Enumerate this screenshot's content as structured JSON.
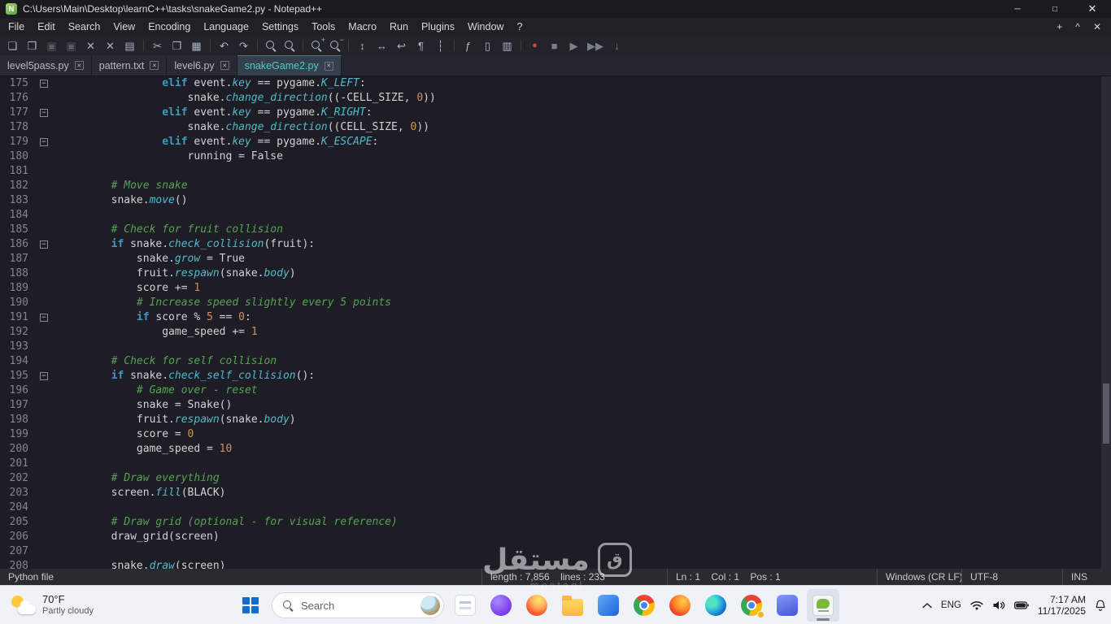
{
  "titlebar": {
    "title": "C:\\Users\\Main\\Desktop\\learnC++\\tasks\\snakeGame2.py - Notepad++",
    "logo_letter": "N",
    "controls": {
      "minimize": "─",
      "maximize": "□",
      "close": "✕"
    }
  },
  "menubar": {
    "items": [
      "File",
      "Edit",
      "Search",
      "View",
      "Encoding",
      "Language",
      "Settings",
      "Tools",
      "Macro",
      "Run",
      "Plugins",
      "Window",
      "?"
    ],
    "right_buttons": [
      {
        "name": "menu-plus-button",
        "glyph": "+"
      },
      {
        "name": "menu-collapse-button",
        "glyph": "^"
      },
      {
        "name": "menu-close-button",
        "glyph": "✕"
      }
    ]
  },
  "toolbar": {
    "icons": [
      {
        "name": "new-file",
        "g": "❏",
        "c": "ic"
      },
      {
        "name": "open-file",
        "g": "❒",
        "c": "ic"
      },
      {
        "name": "save-file",
        "g": "▣",
        "c": "dis"
      },
      {
        "name": "save-all",
        "g": "▣",
        "c": "dis"
      },
      {
        "name": "close-file",
        "g": "✕",
        "c": "ic"
      },
      {
        "name": "close-all",
        "g": "✕",
        "c": "ic"
      },
      {
        "name": "print",
        "g": "▤",
        "c": "ic"
      },
      {
        "sep": true
      },
      {
        "name": "cut",
        "g": "✂",
        "c": "ic"
      },
      {
        "name": "copy",
        "g": "❐",
        "c": "ic"
      },
      {
        "name": "paste",
        "g": "▦",
        "c": "ic"
      },
      {
        "sep": true
      },
      {
        "name": "undo",
        "g": "↶",
        "c": "ic"
      },
      {
        "name": "redo",
        "g": "↷",
        "c": "ic"
      },
      {
        "sep": true
      },
      {
        "name": "find",
        "type": "mag"
      },
      {
        "name": "replace",
        "type": "mag"
      },
      {
        "sep": true
      },
      {
        "name": "zoom-in",
        "type": "mag",
        "badge": "+"
      },
      {
        "name": "zoom-out",
        "type": "mag",
        "badge": "−"
      },
      {
        "sep": true
      },
      {
        "name": "sync-vertical-scrolling",
        "g": "↕",
        "c": "ic"
      },
      {
        "name": "sync-horizontal-scrolling",
        "g": "↔",
        "c": "ic"
      },
      {
        "name": "word-wrap",
        "g": "↩",
        "c": "ic"
      },
      {
        "name": "show-all-characters",
        "g": "¶",
        "c": "ic"
      },
      {
        "name": "indent-guide",
        "g": "┆",
        "c": "ic"
      },
      {
        "sep": true
      },
      {
        "name": "function-list",
        "g": "ƒ",
        "c": "ic"
      },
      {
        "name": "document-map",
        "g": "▯",
        "c": "ic"
      },
      {
        "name": "document-switcher",
        "g": "▥",
        "c": "ic"
      },
      {
        "sep": true
      },
      {
        "name": "record-macro",
        "g": "●",
        "c": "rec"
      },
      {
        "name": "stop-recording",
        "g": "■",
        "c": "dis2"
      },
      {
        "name": "play-macro",
        "g": "▶",
        "c": "dis2"
      },
      {
        "name": "run-macro-multiple-times",
        "g": "▶▶",
        "c": "dis2"
      },
      {
        "name": "save-macro",
        "g": "↓",
        "c": "dis2"
      }
    ]
  },
  "tabbar": {
    "close_glyph": "✕",
    "tabs": [
      {
        "label": "level5pass.py",
        "active": false
      },
      {
        "label": "pattern.txt",
        "active": false
      },
      {
        "label": "level6.py",
        "active": false
      },
      {
        "label": "snakeGame2.py",
        "active": true
      }
    ]
  },
  "editor": {
    "fold_glyph": "−",
    "lines": [
      {
        "n": 175,
        "fold": true,
        "t": [
          [
            "                ",
            "d"
          ],
          [
            "elif",
            "k"
          ],
          [
            " event.",
            "d"
          ],
          [
            "key",
            "m"
          ],
          [
            " == pygame.",
            "d"
          ],
          [
            "K_LEFT",
            "m"
          ],
          [
            ":",
            "d"
          ]
        ]
      },
      {
        "n": 176,
        "t": [
          [
            "                    snake.",
            "d"
          ],
          [
            "change_direction",
            "m"
          ],
          [
            "((-CELL_SIZE, ",
            "d"
          ],
          [
            "0",
            "n"
          ],
          [
            "))",
            "d"
          ]
        ]
      },
      {
        "n": 177,
        "fold": true,
        "t": [
          [
            "                ",
            "d"
          ],
          [
            "elif",
            "k"
          ],
          [
            " event.",
            "d"
          ],
          [
            "key",
            "m"
          ],
          [
            " == pygame.",
            "d"
          ],
          [
            "K_RIGHT",
            "m"
          ],
          [
            ":",
            "d"
          ]
        ]
      },
      {
        "n": 178,
        "t": [
          [
            "                    snake.",
            "d"
          ],
          [
            "change_direction",
            "m"
          ],
          [
            "((CELL_SIZE, ",
            "d"
          ],
          [
            "0",
            "n"
          ],
          [
            "))",
            "d"
          ]
        ]
      },
      {
        "n": 179,
        "fold": true,
        "t": [
          [
            "                ",
            "d"
          ],
          [
            "elif",
            "k"
          ],
          [
            " event.",
            "d"
          ],
          [
            "key",
            "m"
          ],
          [
            " == pygame.",
            "d"
          ],
          [
            "K_ESCAPE",
            "m"
          ],
          [
            ":",
            "d"
          ]
        ]
      },
      {
        "n": 180,
        "t": [
          [
            "                    running = False",
            "d"
          ]
        ]
      },
      {
        "n": 181,
        "t": []
      },
      {
        "n": 182,
        "t": [
          [
            "        ",
            "d"
          ],
          [
            "# Move snake",
            "c"
          ]
        ]
      },
      {
        "n": 183,
        "t": [
          [
            "        snake.",
            "d"
          ],
          [
            "move",
            "m"
          ],
          [
            "()",
            "d"
          ]
        ]
      },
      {
        "n": 184,
        "t": []
      },
      {
        "n": 185,
        "t": [
          [
            "        ",
            "d"
          ],
          [
            "# Check for fruit collision",
            "c"
          ]
        ]
      },
      {
        "n": 186,
        "fold": true,
        "t": [
          [
            "        ",
            "d"
          ],
          [
            "if",
            "k"
          ],
          [
            " snake.",
            "d"
          ],
          [
            "check_collision",
            "m"
          ],
          [
            "(fruit):",
            "d"
          ]
        ]
      },
      {
        "n": 187,
        "t": [
          [
            "            snake.",
            "d"
          ],
          [
            "grow",
            "m"
          ],
          [
            " = True",
            "d"
          ]
        ]
      },
      {
        "n": 188,
        "t": [
          [
            "            fruit.",
            "d"
          ],
          [
            "respawn",
            "m"
          ],
          [
            "(snake.",
            "d"
          ],
          [
            "body",
            "m"
          ],
          [
            ")",
            "d"
          ]
        ]
      },
      {
        "n": 189,
        "t": [
          [
            "            score += ",
            "d"
          ],
          [
            "1",
            "n"
          ]
        ]
      },
      {
        "n": 190,
        "t": [
          [
            "            ",
            "d"
          ],
          [
            "# Increase speed slightly every 5 points",
            "c"
          ]
        ]
      },
      {
        "n": 191,
        "fold": true,
        "t": [
          [
            "            ",
            "d"
          ],
          [
            "if",
            "k"
          ],
          [
            " score % ",
            "d"
          ],
          [
            "5",
            "n"
          ],
          [
            " == ",
            "d"
          ],
          [
            "0",
            "n"
          ],
          [
            ":",
            "d"
          ]
        ]
      },
      {
        "n": 192,
        "t": [
          [
            "                game_speed += ",
            "d"
          ],
          [
            "1",
            "n"
          ]
        ]
      },
      {
        "n": 193,
        "t": []
      },
      {
        "n": 194,
        "t": [
          [
            "        ",
            "d"
          ],
          [
            "# Check for self collision",
            "c"
          ]
        ]
      },
      {
        "n": 195,
        "fold": true,
        "t": [
          [
            "        ",
            "d"
          ],
          [
            "if",
            "k"
          ],
          [
            " snake.",
            "d"
          ],
          [
            "check_self_collision",
            "m"
          ],
          [
            "():",
            "d"
          ]
        ]
      },
      {
        "n": 196,
        "t": [
          [
            "            ",
            "d"
          ],
          [
            "# Game over - reset",
            "c"
          ]
        ]
      },
      {
        "n": 197,
        "t": [
          [
            "            snake = Snake()",
            "d"
          ]
        ]
      },
      {
        "n": 198,
        "t": [
          [
            "            fruit.",
            "d"
          ],
          [
            "respawn",
            "m"
          ],
          [
            "(snake.",
            "d"
          ],
          [
            "body",
            "m"
          ],
          [
            ")",
            "d"
          ]
        ]
      },
      {
        "n": 199,
        "t": [
          [
            "            score = ",
            "d"
          ],
          [
            "0",
            "n"
          ]
        ]
      },
      {
        "n": 200,
        "t": [
          [
            "            game_speed = ",
            "d"
          ],
          [
            "10",
            "n"
          ]
        ]
      },
      {
        "n": 201,
        "t": []
      },
      {
        "n": 202,
        "t": [
          [
            "        ",
            "d"
          ],
          [
            "# Draw everything",
            "c"
          ]
        ]
      },
      {
        "n": 203,
        "t": [
          [
            "        screen.",
            "d"
          ],
          [
            "fill",
            "m"
          ],
          [
            "(BLACK)",
            "d"
          ]
        ]
      },
      {
        "n": 204,
        "t": []
      },
      {
        "n": 205,
        "t": [
          [
            "        ",
            "d"
          ],
          [
            "# Draw grid (optional - for visual reference)",
            "c"
          ]
        ]
      },
      {
        "n": 206,
        "t": [
          [
            "        draw_grid(screen)",
            "d"
          ]
        ]
      },
      {
        "n": 207,
        "t": []
      },
      {
        "n": 208,
        "t": [
          [
            "        snake.",
            "d"
          ],
          [
            "draw",
            "m"
          ],
          [
            "(screen)",
            "d"
          ]
        ]
      }
    ]
  },
  "statusbar": {
    "doc_type": "Python file",
    "length_lines": "length : 7,856    lines : 233",
    "caret": "Ln : 1    Col : 1    Pos : 1",
    "eol": "Windows (CR LF)",
    "encoding": "UTF-8",
    "mode": "INS"
  },
  "watermark": {
    "arabic": "مستقل",
    "logo_glyph": "ق",
    "latin": "mostaql"
  },
  "taskbar": {
    "weather": {
      "temp": "70°F",
      "condition": "Partly cloudy"
    },
    "search": {
      "placeholder": "Search"
    },
    "apps": [
      {
        "name": "white-app-icon",
        "kind": "white"
      },
      {
        "name": "purple-circle-app-icon",
        "kind": "purple"
      },
      {
        "name": "firefox-icon",
        "kind": "firefox"
      },
      {
        "name": "file-explorer-icon",
        "kind": "folder"
      },
      {
        "name": "blue-app-icon",
        "kind": "blue"
      },
      {
        "name": "chrome-icon",
        "kind": "chrome"
      },
      {
        "name": "firefox-secondary-icon",
        "kind": "firefox2"
      },
      {
        "name": "edge-icon",
        "kind": "edge"
      },
      {
        "name": "chrome-notification-icon",
        "kind": "chrome",
        "badge": true
      },
      {
        "name": "blue-gradient-app-icon",
        "kind": "bluegrad"
      },
      {
        "name": "notepad-plus-plus-taskbar-icon",
        "kind": "npp",
        "active": true
      }
    ],
    "tray": {
      "language": "ENG",
      "time": "7:17 AM",
      "date": "11/17/2025"
    }
  }
}
